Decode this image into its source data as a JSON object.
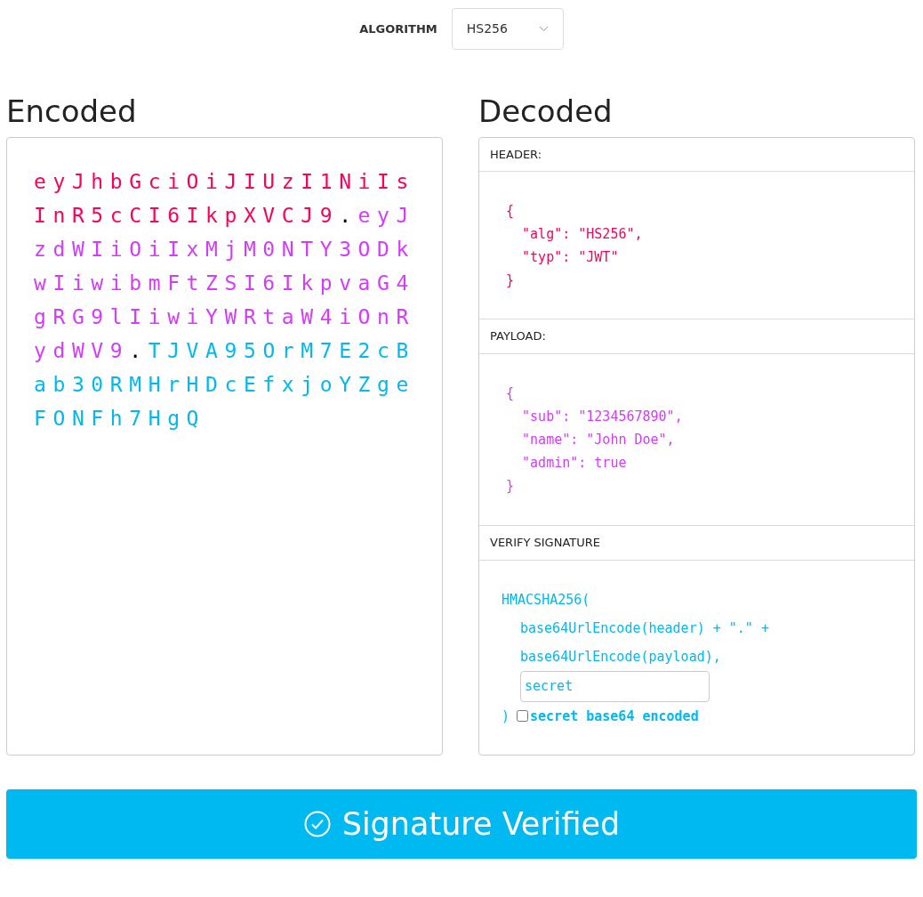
{
  "algorithm": {
    "label": "ALGORITHM",
    "value": "HS256"
  },
  "encoded": {
    "title": "Encoded",
    "segments": [
      {
        "kind": "header",
        "text": "eyJhbGciOiJIUzI1NiIsInR5cCI6IkpXVCJ9"
      },
      {
        "kind": "separator",
        "text": "."
      },
      {
        "kind": "payload",
        "text": "eyJzdWIiOiIxMjM0NTY3ODkwIiwibmFtZSI6IkpvaG4gRG9lIiwiYWRtaW4iOnRydWV9"
      },
      {
        "kind": "separator",
        "text": "."
      },
      {
        "kind": "signature",
        "text": "TJVA95OrM7E2cBab30RMHrHDcEfxjoYZgeFONFh7HgQ"
      }
    ]
  },
  "decoded": {
    "title": "Decoded",
    "header": {
      "title": "HEADER:",
      "code": "{\n  \"alg\": \"HS256\",\n  \"typ\": \"JWT\"\n}"
    },
    "payload": {
      "title": "PAYLOAD:",
      "code": "{\n  \"sub\": \"1234567890\",\n  \"name\": \"John Doe\",\n  \"admin\": true\n}"
    },
    "verify": {
      "title": "VERIFY SIGNATURE",
      "opening": "HMACSHA256(",
      "lines": [
        "base64UrlEncode(header) + \".\" +",
        "base64UrlEncode(payload),"
      ],
      "secret": "secret",
      "closing": ")",
      "base64_checkbox": {
        "label": "secret base64 encoded",
        "checked": false
      }
    }
  },
  "verify_button": {
    "label": "Signature Verified"
  }
}
